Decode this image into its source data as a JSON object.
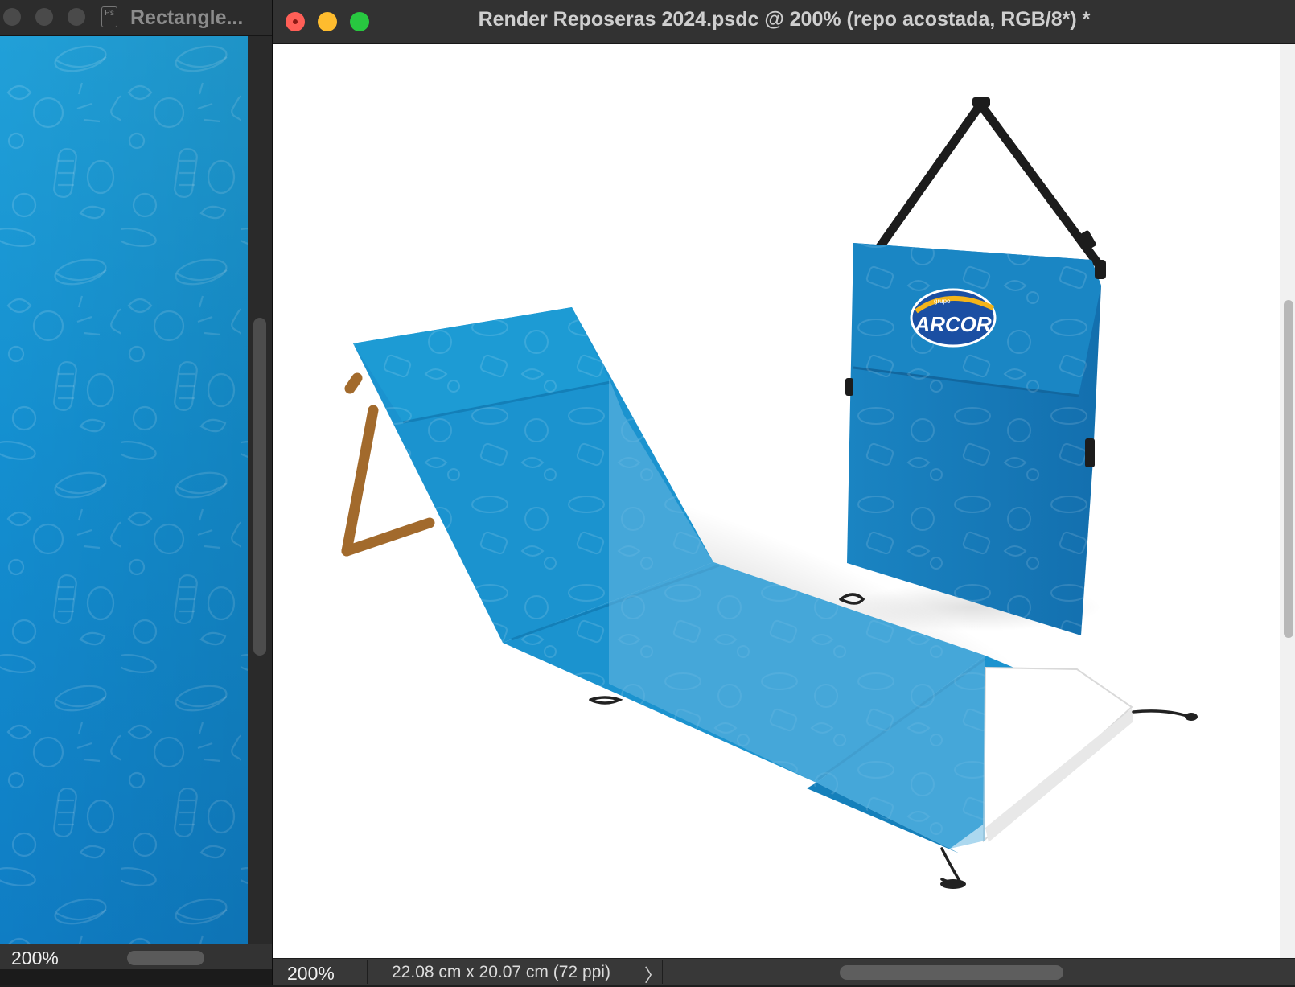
{
  "left_window": {
    "title": "Rectangle...",
    "file_icon_label": "Ps",
    "zoom": "200%"
  },
  "right_window": {
    "title": "Render Reposeras 2024.psdc @ 200% (repo acostada, RGB/8*) *",
    "zoom": "200%",
    "doc_info": "22.08 cm x 20.07 cm (72 ppi)",
    "info_arrow": "〉"
  },
  "canvas": {
    "brand_logo_text": "ARCOR",
    "brand_logo_small_text": "grupo"
  },
  "colors": {
    "pattern_blue": "#1a8fcf",
    "lounger_blue": "#1b93cf",
    "overlay_blue": "#5eb0dc",
    "bag_blue": "#1676b5",
    "frame_wood": "#a26a2c",
    "logo_yellow": "#f4b41a",
    "close": "#ff5f57",
    "minimize": "#febc2e",
    "maximize": "#28c840"
  }
}
